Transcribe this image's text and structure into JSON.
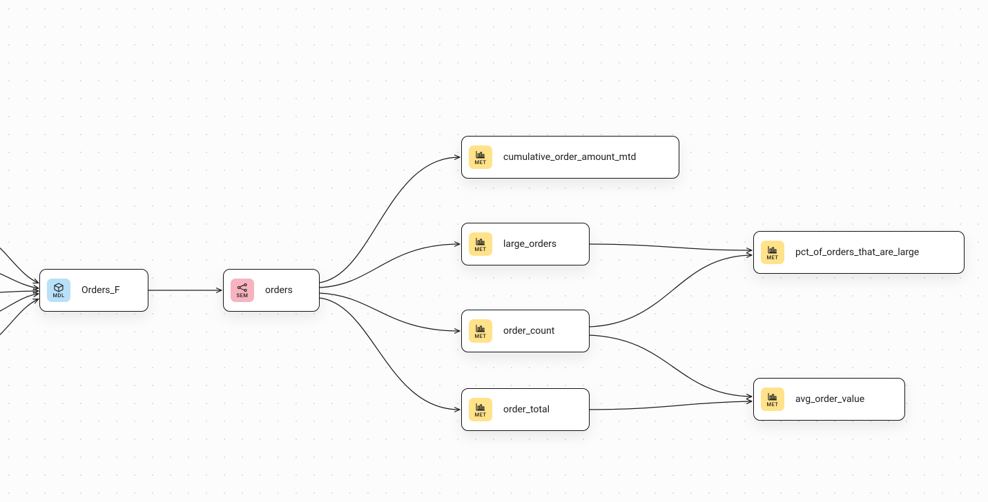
{
  "badges": {
    "mdl": {
      "label": "MDL",
      "color": "#b8e0f7",
      "icon": "cube"
    },
    "sem": {
      "label": "SEM",
      "color": "#f7b3be",
      "icon": "branch"
    },
    "met": {
      "label": "MET",
      "color": "#ffe28a",
      "icon": "bar-chart"
    }
  },
  "nodes": {
    "orders_f": {
      "badge": "mdl",
      "label": "Orders_F"
    },
    "orders": {
      "badge": "sem",
      "label": "orders"
    },
    "cumulative": {
      "badge": "met",
      "label": "cumulative_order_amount_mtd"
    },
    "large": {
      "badge": "met",
      "label": "large_orders"
    },
    "count": {
      "badge": "met",
      "label": "order_count"
    },
    "total": {
      "badge": "met",
      "label": "order_total"
    },
    "pct": {
      "badge": "met",
      "label": "pct_of_orders_that_are_large"
    },
    "avg": {
      "badge": "met",
      "label": "avg_order_value"
    }
  },
  "edges": [
    {
      "from": "offscreen1",
      "to": "orders_f"
    },
    {
      "from": "offscreen2",
      "to": "orders_f"
    },
    {
      "from": "offscreen3",
      "to": "orders_f"
    },
    {
      "from": "offscreen4",
      "to": "orders_f"
    },
    {
      "from": "offscreen5",
      "to": "orders_f"
    },
    {
      "from": "orders_f",
      "to": "orders"
    },
    {
      "from": "orders",
      "to": "cumulative"
    },
    {
      "from": "orders",
      "to": "large"
    },
    {
      "from": "orders",
      "to": "count"
    },
    {
      "from": "orders",
      "to": "total"
    },
    {
      "from": "large",
      "to": "pct"
    },
    {
      "from": "count",
      "to": "pct"
    },
    {
      "from": "count",
      "to": "avg"
    },
    {
      "from": "total",
      "to": "avg"
    }
  ]
}
